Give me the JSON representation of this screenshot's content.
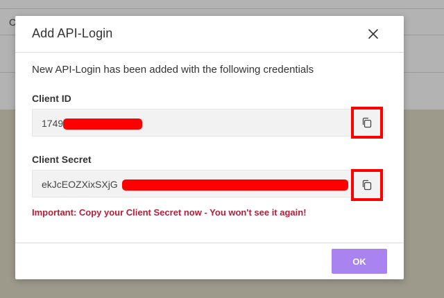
{
  "background": {
    "row_text": "C"
  },
  "modal": {
    "title": "Add API-Login",
    "intro": "New API-Login has been added with the following credentials",
    "client_id": {
      "label": "Client ID",
      "value_visible": "1749"
    },
    "client_secret": {
      "label": "Client Secret",
      "value_visible": "ekJcEOZXixSXjG"
    },
    "warning": "Important: Copy your Client Secret now - You won't see it again!",
    "ok_label": "OK"
  },
  "colors": {
    "accent_button": "#a984f0",
    "warning_text": "#b0203a",
    "redaction": "#ff0000"
  },
  "icons": {
    "close": "close-icon",
    "copy": "copy-icon"
  }
}
